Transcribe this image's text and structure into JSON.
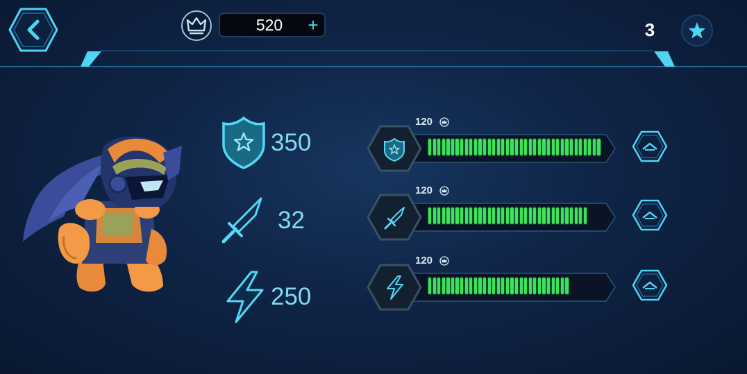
{
  "header": {
    "back_icon": "chevron-left-icon",
    "currency_icon": "crown-icon",
    "currency_value": "520",
    "currency_plus": "+",
    "star_count": "3",
    "star_icon": "star-icon"
  },
  "hero": {
    "image": "armored-hero-character"
  },
  "stats": [
    {
      "icon": "shield-icon",
      "value": "350"
    },
    {
      "icon": "sword-icon",
      "value": "32"
    },
    {
      "icon": "lightning-icon",
      "value": "250"
    }
  ],
  "upgrades": [
    {
      "icon": "shield-icon",
      "cost": "120",
      "cost_icon": "crown-icon",
      "level_fraction": 0.985,
      "button_icon": "chevron-up-icon"
    },
    {
      "icon": "sword-icon",
      "cost": "120",
      "cost_icon": "crown-icon",
      "level_fraction": 0.895,
      "button_icon": "chevron-up-icon"
    },
    {
      "icon": "lightning-icon",
      "cost": "120",
      "cost_icon": "crown-icon",
      "level_fraction": 0.79,
      "button_icon": "chevron-up-icon"
    }
  ],
  "colors": {
    "accent": "#4fd4f2",
    "bar_fill": "#3ee05c",
    "stat_text": "#7fdcf2",
    "background": "#0f2446"
  }
}
